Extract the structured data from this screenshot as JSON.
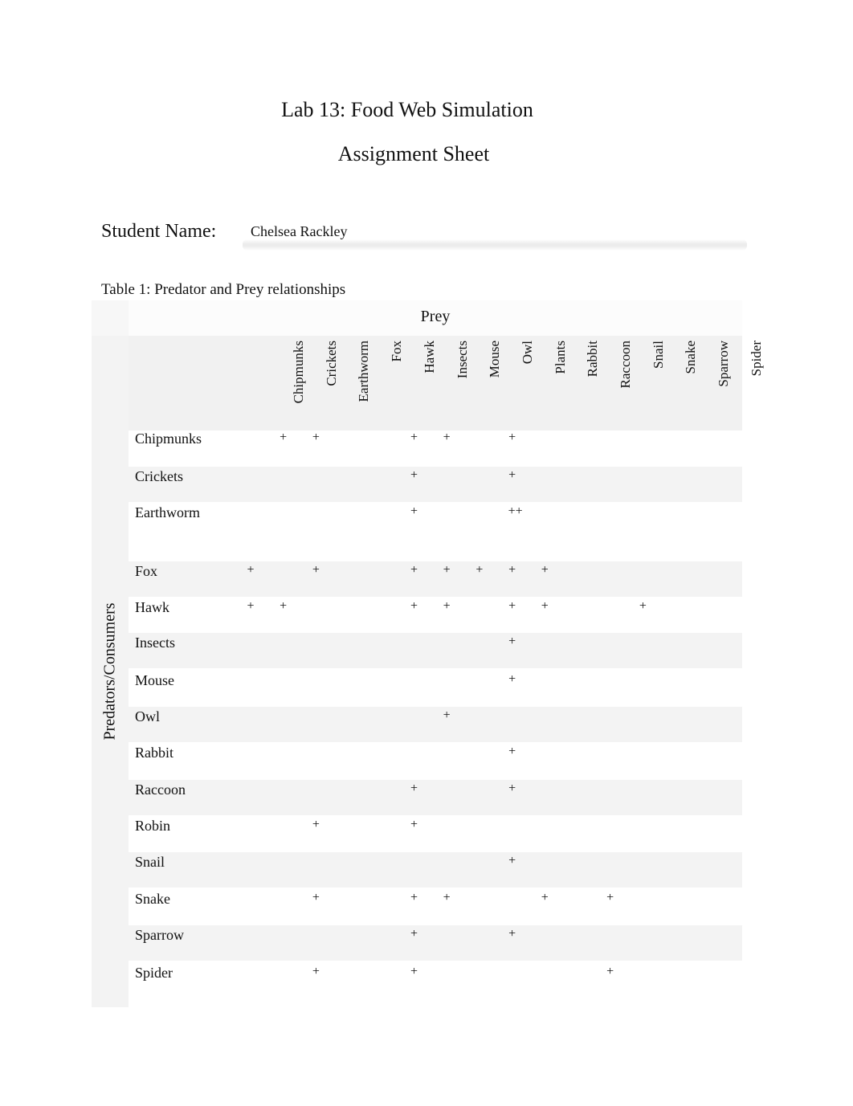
{
  "document": {
    "title_line1": "Lab 13: Food Web Simulation",
    "title_line2": "Assignment Sheet",
    "student_name_label": "Student Name:",
    "student_name_value": "Chelsea Rackley",
    "table_caption": "Table 1: Predator and Prey relationships"
  },
  "table": {
    "prey_header": "Prey",
    "predator_header": "Predators/Consumers",
    "columns": [
      "Chipmunks",
      "Crickets",
      "Earthworm",
      "Fox",
      "Hawk",
      "Insects",
      "Mouse",
      "Owl",
      "Plants",
      "Rabbit",
      "Raccoon",
      "Snail",
      "Snake",
      "Sparrow",
      "Spider"
    ],
    "rows": [
      {
        "name": "Chipmunks",
        "marks": {
          "Crickets": "+",
          "Earthworm": "+",
          "Insects": "+",
          "Mouse": "+",
          "Plants": "+"
        }
      },
      {
        "name": "Crickets",
        "marks": {
          "Insects": "+",
          "Plants": "+"
        }
      },
      {
        "name": "Earthworm",
        "marks": {
          "Insects": "+",
          "Plants": "++"
        }
      },
      {
        "name": "Fox",
        "marks": {
          "Chipmunks": "+",
          "Earthworm": "+",
          "Insects": "+",
          "Mouse": "+",
          "Owl": "+",
          "Plants": "+",
          "Rabbit": "+"
        }
      },
      {
        "name": "Hawk",
        "marks": {
          "Chipmunks": "+",
          "Crickets": "+",
          "Insects": "+",
          "Mouse": "+",
          "Plants": "+",
          "Rabbit": "+",
          "Snake": "+"
        }
      },
      {
        "name": "Insects",
        "marks": {
          "Plants": "+"
        }
      },
      {
        "name": "Mouse",
        "marks": {
          "Plants": "+"
        }
      },
      {
        "name": "Owl",
        "marks": {
          "Mouse": "+"
        }
      },
      {
        "name": "Rabbit",
        "marks": {
          "Plants": "+"
        }
      },
      {
        "name": "Raccoon",
        "marks": {
          "Insects": "+",
          "Plants": "+"
        }
      },
      {
        "name": "Robin",
        "marks": {
          "Earthworm": "+",
          "Insects": "+"
        }
      },
      {
        "name": "Snail",
        "marks": {
          "Plants": "+"
        }
      },
      {
        "name": "Snake",
        "marks": {
          "Earthworm": "+",
          "Insects": "+",
          "Mouse": "+",
          "Rabbit": "+",
          "Snail": "+"
        }
      },
      {
        "name": "Sparrow",
        "marks": {
          "Insects": "+",
          "Plants": "+"
        }
      },
      {
        "name": "Spider",
        "marks": {
          "Earthworm": "+",
          "Insects": "+",
          "Snail": "+"
        }
      }
    ]
  }
}
